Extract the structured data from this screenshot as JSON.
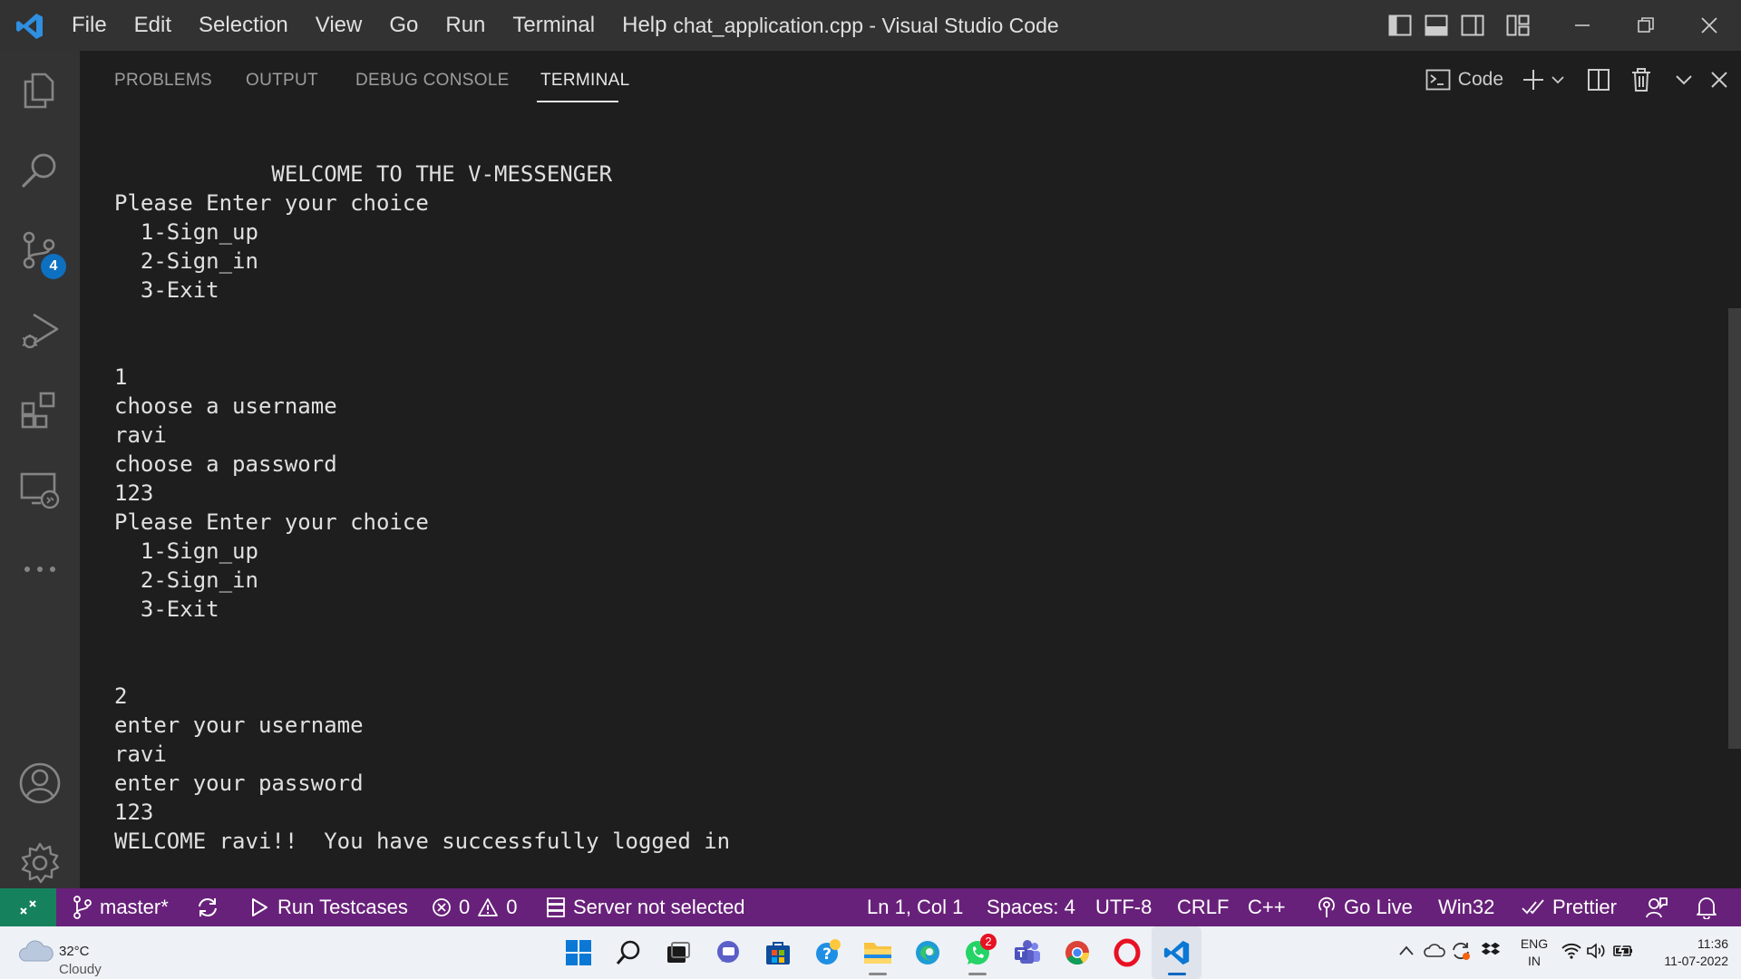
{
  "window": {
    "title": "chat_application.cpp - Visual Studio Code"
  },
  "menu": [
    "File",
    "Edit",
    "Selection",
    "View",
    "Go",
    "Run",
    "Terminal",
    "Help"
  ],
  "activity_bar": {
    "source_control_badge": "4"
  },
  "panel": {
    "tabs": [
      "PROBLEMS",
      "OUTPUT",
      "DEBUG CONSOLE",
      "TERMINAL"
    ],
    "active_tab": "TERMINAL",
    "terminal_profile": "Code"
  },
  "terminal": {
    "lines": [
      "            WELCOME TO THE V-MESSENGER",
      "Please Enter your choice",
      "  1-Sign_up",
      "  2-Sign_in",
      "  3-Exit",
      "",
      "",
      "1",
      "choose a username",
      "ravi",
      "choose a password",
      "123",
      "Please Enter your choice",
      "  1-Sign_up",
      "  2-Sign_in",
      "  3-Exit",
      "",
      "",
      "2",
      "enter your username",
      "ravi",
      "enter your password",
      "123",
      "WELCOME ravi!!  You have successfully logged in"
    ]
  },
  "statusbar": {
    "branch": "master*",
    "run_testcases": "Run Testcases",
    "errors": "0",
    "warnings": "0",
    "server": "Server not selected",
    "position": "Ln 1, Col 1",
    "spaces": "Spaces: 4",
    "encoding": "UTF-8",
    "eol": "CRLF",
    "language": "C++",
    "go_live": "Go Live",
    "platform": "Win32",
    "prettier": "Prettier"
  },
  "taskbar": {
    "weather_temp": "32°C",
    "weather_cond": "Cloudy",
    "whatsapp_badge": "2",
    "lang_1": "ENG",
    "lang_2": "IN",
    "time": "11:36",
    "date": "11-07-2022"
  },
  "colors": {
    "titlebar": "#323233",
    "activity_bar": "#333333",
    "panel_bg": "#1e1e1e",
    "statusbar": "#68217a",
    "remote_button": "#16825d",
    "badge": "#0e70c0",
    "taskbar": "#eef1f6"
  }
}
